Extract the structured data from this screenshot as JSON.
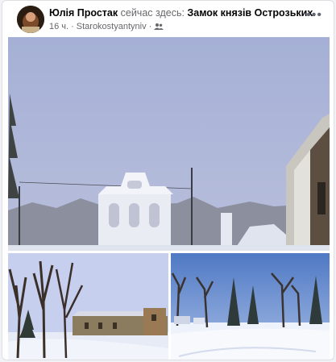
{
  "post": {
    "author": "Юлія Простак",
    "action": "сейчас здесь:",
    "place": "Замок князів Острозьких.",
    "time": "16 ч.",
    "location": "Starokostyantyniv",
    "separator": "·",
    "privacy_icon": "friends-icon",
    "more_label": "•••"
  },
  "photos": [
    {
      "name": "photo-main",
      "icon": "castle-bell-tower-scene"
    },
    {
      "name": "photo-bottom-left",
      "icon": "castle-courtyard-trees-scene"
    },
    {
      "name": "photo-bottom-right",
      "icon": "snowy-park-scene"
    }
  ],
  "colors": {
    "sky_main": "#aeb7d8",
    "sky_left": "#c7d1f0",
    "sky_right": "#5d86c9",
    "snow": "#e8eef8",
    "text_secondary": "#65676b"
  }
}
